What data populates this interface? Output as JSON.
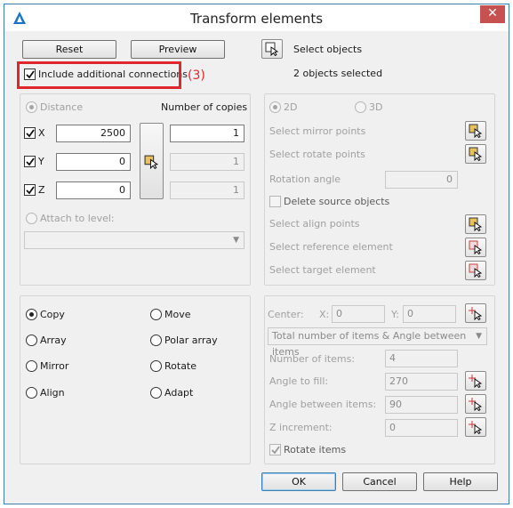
{
  "window": {
    "title": "Transform elements",
    "close_symbol": "✕"
  },
  "top": {
    "reset_label": "Reset",
    "preview_label": "Preview",
    "select_objects_label": "Select objects",
    "objects_selected_text": "2 objects selected",
    "include_connections_label": "Include additional connections",
    "include_connections_checked": true,
    "annotation_text": "(3)"
  },
  "translate": {
    "distance_label": "Distance",
    "number_of_copies_label": "Number of copies",
    "x_label": "X",
    "x_value": "2500",
    "x_copies": "1",
    "y_label": "Y",
    "y_value": "0",
    "y_copies": "1",
    "z_label": "Z",
    "z_value": "0",
    "z_copies": "1",
    "attach_label": "Attach to level:",
    "attach_value": ""
  },
  "mirror_rotate": {
    "mode_2d": "2D",
    "mode_3d": "3D",
    "select_mirror_points": "Select mirror points",
    "select_rotate_points": "Select rotate points",
    "rotation_angle_label": "Rotation angle",
    "rotation_angle_value": "0",
    "delete_source_label": "Delete source objects",
    "select_align_points": "Select align points",
    "select_reference_element": "Select reference element",
    "select_target_element": "Select target element"
  },
  "operations": {
    "copy": "Copy",
    "move": "Move",
    "array": "Array",
    "polar_array": "Polar array",
    "mirror": "Mirror",
    "rotate": "Rotate",
    "align": "Align",
    "adapt": "Adapt",
    "selected": "copy"
  },
  "polar": {
    "center_label": "Center:",
    "x_label": "X:",
    "x_value": "0",
    "y_label": "Y:",
    "y_value": "0",
    "mode_select_value": "Total number of items & Angle between items",
    "number_of_items_label": "Number of items:",
    "number_of_items_value": "4",
    "angle_to_fill_label": "Angle to fill:",
    "angle_to_fill_value": "270",
    "angle_between_label": "Angle between items:",
    "angle_between_value": "90",
    "z_increment_label": "Z increment:",
    "z_increment_value": "0",
    "rotate_items_label": "Rotate items"
  },
  "footer": {
    "ok_label": "OK",
    "cancel_label": "Cancel",
    "help_label": "Help"
  },
  "colors": {
    "accent_red": "#e0262e",
    "close_red": "#c75050",
    "border_blue": "#3c7fb1"
  }
}
